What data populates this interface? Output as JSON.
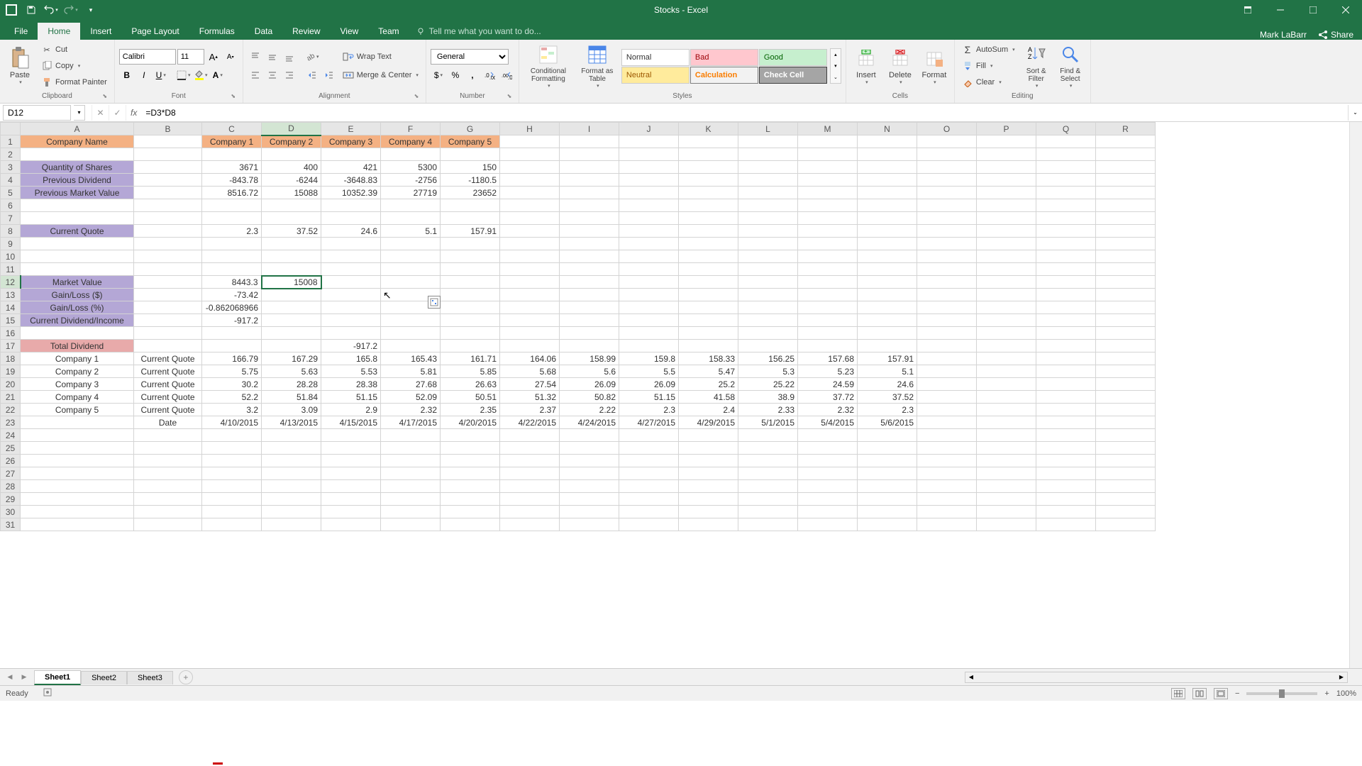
{
  "app": {
    "title": "Stocks - Excel",
    "user": "Mark LaBarr",
    "share": "Share"
  },
  "tabs": {
    "file": "File",
    "home": "Home",
    "insert": "Insert",
    "pageLayout": "Page Layout",
    "formulas": "Formulas",
    "data": "Data",
    "review": "Review",
    "view": "View",
    "team": "Team",
    "tellMe": "Tell me what you want to do..."
  },
  "ribbon": {
    "clipboard": {
      "paste": "Paste",
      "cut": "Cut",
      "copy": "Copy",
      "formatPainter": "Format Painter",
      "label": "Clipboard"
    },
    "font": {
      "name": "Calibri",
      "size": "11",
      "label": "Font"
    },
    "alignment": {
      "wrapText": "Wrap Text",
      "mergeCenter": "Merge & Center",
      "label": "Alignment"
    },
    "number": {
      "format": "General",
      "label": "Number"
    },
    "styles": {
      "conditional": "Conditional Formatting",
      "formatAs": "Format as Table",
      "normal": "Normal",
      "bad": "Bad",
      "good": "Good",
      "neutral": "Neutral",
      "calculation": "Calculation",
      "checkCell": "Check Cell",
      "label": "Styles"
    },
    "cells": {
      "insert": "Insert",
      "delete": "Delete",
      "format": "Format",
      "label": "Cells"
    },
    "editing": {
      "autoSum": "AutoSum",
      "fill": "Fill",
      "clear": "Clear",
      "sortFilter": "Sort & Filter",
      "findSelect": "Find & Select",
      "label": "Editing"
    }
  },
  "formulaBar": {
    "nameBox": "D12",
    "formula": "=D3*D8"
  },
  "columns": [
    "A",
    "B",
    "C",
    "D",
    "E",
    "F",
    "G",
    "H",
    "I",
    "J",
    "K",
    "L",
    "M",
    "N",
    "O",
    "P",
    "Q",
    "R"
  ],
  "data": {
    "r1": {
      "A": "Company Name",
      "C": "Company 1",
      "D": "Company 2",
      "E": "Company 3",
      "F": "Company 4",
      "G": "Company 5"
    },
    "r3": {
      "A": "Quantity of Shares",
      "C": "3671",
      "D": "400",
      "E": "421",
      "F": "5300",
      "G": "150"
    },
    "r4": {
      "A": "Previous Dividend",
      "C": "-843.78",
      "D": "-6244",
      "E": "-3648.83",
      "F": "-2756",
      "G": "-1180.5"
    },
    "r5": {
      "A": "Previous Market Value",
      "C": "8516.72",
      "D": "15088",
      "E": "10352.39",
      "F": "27719",
      "G": "23652"
    },
    "r8": {
      "A": "Current Quote",
      "C": "2.3",
      "D": "37.52",
      "E": "24.6",
      "F": "5.1",
      "G": "157.91"
    },
    "r12": {
      "A": "Market Value",
      "C": "8443.3",
      "D": "15008"
    },
    "r13": {
      "A": "Gain/Loss ($)",
      "C": "-73.42"
    },
    "r14": {
      "A": "Gain/Loss (%)",
      "C": "-0.862068966"
    },
    "r15": {
      "A": "Current Dividend/Income",
      "C": "-917.2"
    },
    "r17": {
      "A": "Total Dividend",
      "E": "-917.2"
    },
    "r18": {
      "A": "Company 1",
      "B": "Current Quote",
      "C": "166.79",
      "D": "167.29",
      "E": "165.8",
      "F": "165.43",
      "G": "161.71",
      "H": "164.06",
      "I": "158.99",
      "J": "159.8",
      "K": "158.33",
      "L": "156.25",
      "M": "157.68",
      "N": "157.91"
    },
    "r19": {
      "A": "Company 2",
      "B": "Current Quote",
      "C": "5.75",
      "D": "5.63",
      "E": "5.53",
      "F": "5.81",
      "G": "5.85",
      "H": "5.68",
      "I": "5.6",
      "J": "5.5",
      "K": "5.47",
      "L": "5.3",
      "M": "5.23",
      "N": "5.1"
    },
    "r20": {
      "A": "Company 3",
      "B": "Current Quote",
      "C": "30.2",
      "D": "28.28",
      "E": "28.38",
      "F": "27.68",
      "G": "26.63",
      "H": "27.54",
      "I": "26.09",
      "J": "26.09",
      "K": "25.2",
      "L": "25.22",
      "M": "24.59",
      "N": "24.6"
    },
    "r21": {
      "A": "Company 4",
      "B": "Current Quote",
      "C": "52.2",
      "D": "51.84",
      "E": "51.15",
      "F": "52.09",
      "G": "50.51",
      "H": "51.32",
      "I": "50.82",
      "J": "51.15",
      "K": "41.58",
      "L": "38.9",
      "M": "37.72",
      "N": "37.52"
    },
    "r22": {
      "A": "Company 5",
      "B": "Current Quote",
      "C": "3.2",
      "D": "3.09",
      "E": "2.9",
      "F": "2.32",
      "G": "2.35",
      "H": "2.37",
      "I": "2.22",
      "J": "2.3",
      "K": "2.4",
      "L": "2.33",
      "M": "2.32",
      "N": "2.3"
    },
    "r23": {
      "B": "Date",
      "C": "4/10/2015",
      "D": "4/13/2015",
      "E": "4/15/2015",
      "F": "4/17/2015",
      "G": "4/20/2015",
      "H": "4/22/2015",
      "I": "4/24/2015",
      "J": "4/27/2015",
      "K": "4/29/2015",
      "L": "5/1/2015",
      "M": "5/4/2015",
      "N": "5/6/2015"
    }
  },
  "sheets": {
    "s1": "Sheet1",
    "s2": "Sheet2",
    "s3": "Sheet3"
  },
  "status": {
    "ready": "Ready",
    "zoom": "100%"
  }
}
